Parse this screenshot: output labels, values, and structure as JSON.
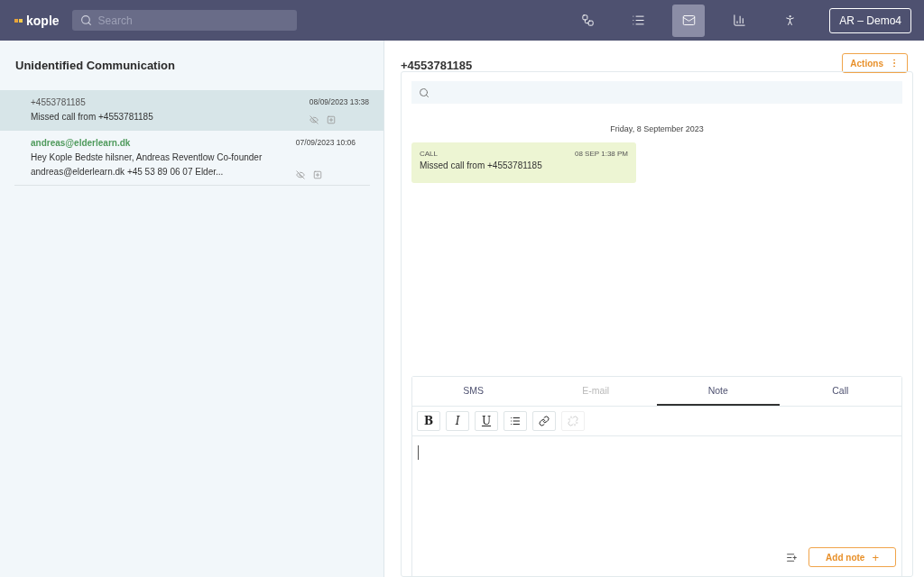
{
  "header": {
    "logo": "kople",
    "search": {
      "placeholder": "Search"
    },
    "nav": [
      {
        "kind": "flow",
        "selected": false
      },
      {
        "kind": "list",
        "selected": false
      },
      {
        "kind": "mail",
        "selected": true
      },
      {
        "kind": "chart",
        "selected": false
      },
      {
        "kind": "person",
        "selected": false
      }
    ],
    "account": "AR – Demo4"
  },
  "inbox": {
    "title": "Unidentified Communication",
    "items": [
      {
        "sender": "+4553781185",
        "identified": false,
        "date": "08/09/2023 13:38",
        "preview": "Missed call from +4553781185",
        "selected": true
      },
      {
        "sender": "andreas@elderlearn.dk",
        "identified": true,
        "date": "07/09/2023 10:06",
        "preview": "Hey Kople Bedste hilsner, Andreas Reventlow Co-founder andreas@elderlearn.dk +45 53 89 06 07 Elder...",
        "selected": false
      }
    ]
  },
  "conversation": {
    "title": "+4553781185",
    "actions": "Actions",
    "day": "Friday, 8 September 2023",
    "messages": [
      {
        "type": "CALL",
        "time": "08 SEP 1:38 PM",
        "text": "Missed call from +4553781185"
      }
    ]
  },
  "composer": {
    "tabs": [
      {
        "label": "SMS",
        "selected": false,
        "disabled": false
      },
      {
        "label": "E-mail",
        "selected": false,
        "disabled": true
      },
      {
        "label": "Note",
        "selected": true,
        "disabled": false
      },
      {
        "label": "Call",
        "selected": false,
        "disabled": false
      }
    ],
    "tools": [
      {
        "kind": "bold",
        "label": "B",
        "disabled": false
      },
      {
        "kind": "italic",
        "label": "I",
        "disabled": false
      },
      {
        "kind": "underline",
        "label": "U",
        "disabled": false
      },
      {
        "kind": "list",
        "disabled": false
      },
      {
        "kind": "link",
        "disabled": false
      },
      {
        "kind": "unlink",
        "disabled": true
      }
    ],
    "submit": "Add note",
    "submit_icon": "+"
  }
}
